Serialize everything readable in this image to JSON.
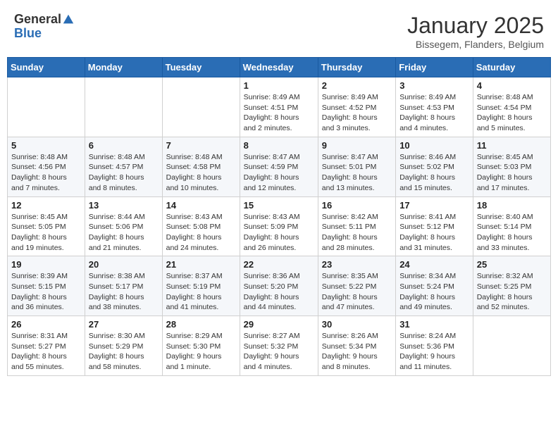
{
  "header": {
    "logo_general": "General",
    "logo_blue": "Blue",
    "month_title": "January 2025",
    "location": "Bissegem, Flanders, Belgium"
  },
  "weekdays": [
    "Sunday",
    "Monday",
    "Tuesday",
    "Wednesday",
    "Thursday",
    "Friday",
    "Saturday"
  ],
  "weeks": [
    [
      {
        "day": "",
        "info": ""
      },
      {
        "day": "",
        "info": ""
      },
      {
        "day": "",
        "info": ""
      },
      {
        "day": "1",
        "info": "Sunrise: 8:49 AM\nSunset: 4:51 PM\nDaylight: 8 hours\nand 2 minutes."
      },
      {
        "day": "2",
        "info": "Sunrise: 8:49 AM\nSunset: 4:52 PM\nDaylight: 8 hours\nand 3 minutes."
      },
      {
        "day": "3",
        "info": "Sunrise: 8:49 AM\nSunset: 4:53 PM\nDaylight: 8 hours\nand 4 minutes."
      },
      {
        "day": "4",
        "info": "Sunrise: 8:48 AM\nSunset: 4:54 PM\nDaylight: 8 hours\nand 5 minutes."
      }
    ],
    [
      {
        "day": "5",
        "info": "Sunrise: 8:48 AM\nSunset: 4:56 PM\nDaylight: 8 hours\nand 7 minutes."
      },
      {
        "day": "6",
        "info": "Sunrise: 8:48 AM\nSunset: 4:57 PM\nDaylight: 8 hours\nand 8 minutes."
      },
      {
        "day": "7",
        "info": "Sunrise: 8:48 AM\nSunset: 4:58 PM\nDaylight: 8 hours\nand 10 minutes."
      },
      {
        "day": "8",
        "info": "Sunrise: 8:47 AM\nSunset: 4:59 PM\nDaylight: 8 hours\nand 12 minutes."
      },
      {
        "day": "9",
        "info": "Sunrise: 8:47 AM\nSunset: 5:01 PM\nDaylight: 8 hours\nand 13 minutes."
      },
      {
        "day": "10",
        "info": "Sunrise: 8:46 AM\nSunset: 5:02 PM\nDaylight: 8 hours\nand 15 minutes."
      },
      {
        "day": "11",
        "info": "Sunrise: 8:45 AM\nSunset: 5:03 PM\nDaylight: 8 hours\nand 17 minutes."
      }
    ],
    [
      {
        "day": "12",
        "info": "Sunrise: 8:45 AM\nSunset: 5:05 PM\nDaylight: 8 hours\nand 19 minutes."
      },
      {
        "day": "13",
        "info": "Sunrise: 8:44 AM\nSunset: 5:06 PM\nDaylight: 8 hours\nand 21 minutes."
      },
      {
        "day": "14",
        "info": "Sunrise: 8:43 AM\nSunset: 5:08 PM\nDaylight: 8 hours\nand 24 minutes."
      },
      {
        "day": "15",
        "info": "Sunrise: 8:43 AM\nSunset: 5:09 PM\nDaylight: 8 hours\nand 26 minutes."
      },
      {
        "day": "16",
        "info": "Sunrise: 8:42 AM\nSunset: 5:11 PM\nDaylight: 8 hours\nand 28 minutes."
      },
      {
        "day": "17",
        "info": "Sunrise: 8:41 AM\nSunset: 5:12 PM\nDaylight: 8 hours\nand 31 minutes."
      },
      {
        "day": "18",
        "info": "Sunrise: 8:40 AM\nSunset: 5:14 PM\nDaylight: 8 hours\nand 33 minutes."
      }
    ],
    [
      {
        "day": "19",
        "info": "Sunrise: 8:39 AM\nSunset: 5:15 PM\nDaylight: 8 hours\nand 36 minutes."
      },
      {
        "day": "20",
        "info": "Sunrise: 8:38 AM\nSunset: 5:17 PM\nDaylight: 8 hours\nand 38 minutes."
      },
      {
        "day": "21",
        "info": "Sunrise: 8:37 AM\nSunset: 5:19 PM\nDaylight: 8 hours\nand 41 minutes."
      },
      {
        "day": "22",
        "info": "Sunrise: 8:36 AM\nSunset: 5:20 PM\nDaylight: 8 hours\nand 44 minutes."
      },
      {
        "day": "23",
        "info": "Sunrise: 8:35 AM\nSunset: 5:22 PM\nDaylight: 8 hours\nand 47 minutes."
      },
      {
        "day": "24",
        "info": "Sunrise: 8:34 AM\nSunset: 5:24 PM\nDaylight: 8 hours\nand 49 minutes."
      },
      {
        "day": "25",
        "info": "Sunrise: 8:32 AM\nSunset: 5:25 PM\nDaylight: 8 hours\nand 52 minutes."
      }
    ],
    [
      {
        "day": "26",
        "info": "Sunrise: 8:31 AM\nSunset: 5:27 PM\nDaylight: 8 hours\nand 55 minutes."
      },
      {
        "day": "27",
        "info": "Sunrise: 8:30 AM\nSunset: 5:29 PM\nDaylight: 8 hours\nand 58 minutes."
      },
      {
        "day": "28",
        "info": "Sunrise: 8:29 AM\nSunset: 5:30 PM\nDaylight: 9 hours\nand 1 minute."
      },
      {
        "day": "29",
        "info": "Sunrise: 8:27 AM\nSunset: 5:32 PM\nDaylight: 9 hours\nand 4 minutes."
      },
      {
        "day": "30",
        "info": "Sunrise: 8:26 AM\nSunset: 5:34 PM\nDaylight: 9 hours\nand 8 minutes."
      },
      {
        "day": "31",
        "info": "Sunrise: 8:24 AM\nSunset: 5:36 PM\nDaylight: 9 hours\nand 11 minutes."
      },
      {
        "day": "",
        "info": ""
      }
    ]
  ]
}
